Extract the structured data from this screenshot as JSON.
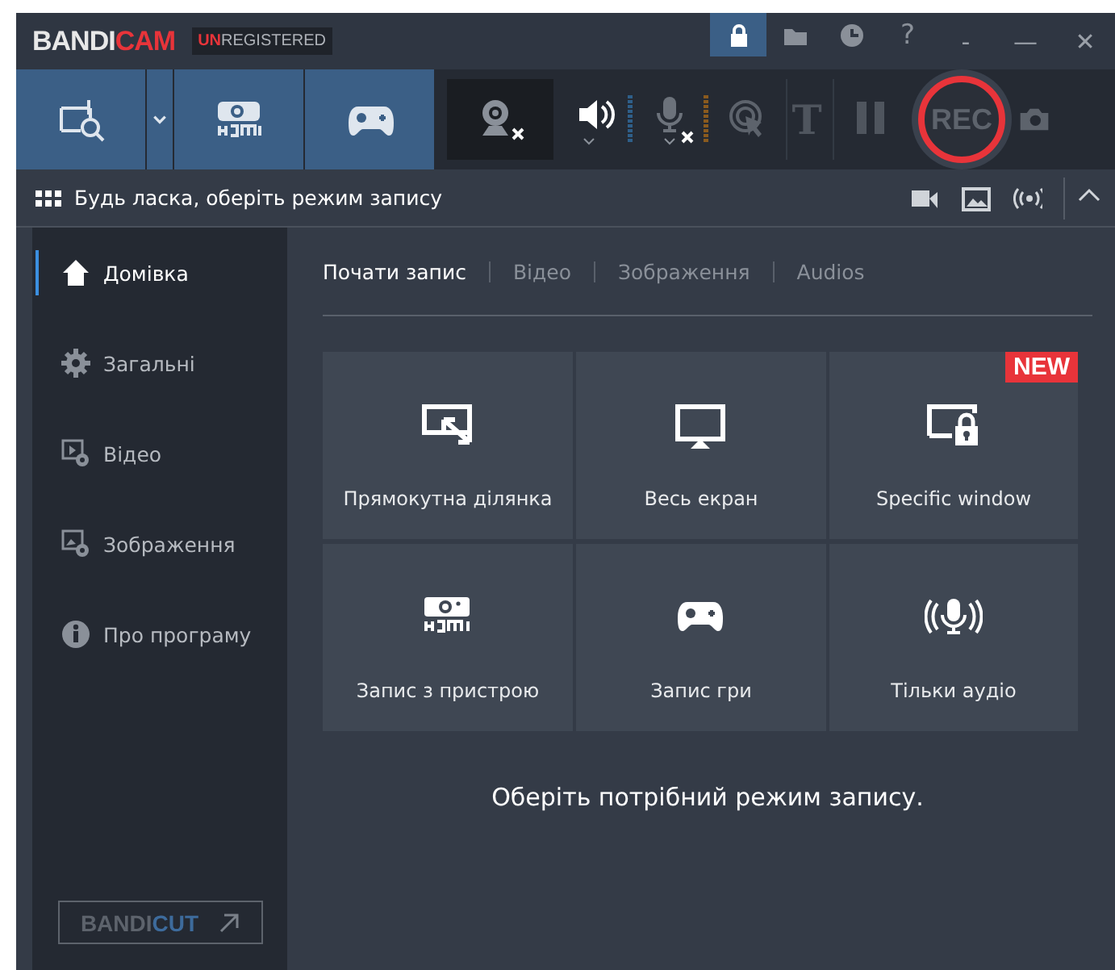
{
  "title_bar": {
    "logo": [
      "BANDI",
      "CAM"
    ],
    "badge": [
      "UN",
      "REGISTERED"
    ],
    "tools": [
      {
        "kind": "lock",
        "selected": true
      },
      {
        "kind": "folder",
        "selected": false
      },
      {
        "kind": "clock",
        "selected": false
      },
      {
        "kind": "help",
        "label": "?",
        "selected": false
      }
    ],
    "window_controls": [
      "-",
      "—",
      "✕"
    ]
  },
  "toolbar": {
    "modes": [
      {
        "kind": "rectangle"
      },
      {
        "kind": "dropdown"
      },
      {
        "kind": "hdmi"
      },
      {
        "kind": "gamepad"
      }
    ],
    "devices": [
      {
        "kind": "webcam",
        "off": true
      },
      {
        "kind": "speaker",
        "off": false
      },
      {
        "kind": "mic",
        "off": true
      },
      {
        "kind": "cursor",
        "off": false
      },
      {
        "kind": "text",
        "label": "T",
        "off": false
      },
      {
        "kind": "pause",
        "off": false
      }
    ],
    "record": "REC"
  },
  "mode_bar": {
    "message": "Будь ласка, оберіть режим запису",
    "icons": [
      {
        "kind": "video"
      },
      {
        "kind": "image"
      },
      {
        "kind": "broadcast"
      },
      {
        "kind": "collapse"
      }
    ]
  },
  "sidebar": {
    "items": [
      {
        "kind": "home",
        "label": "Домівка",
        "selected": true
      },
      {
        "kind": "gear",
        "label": "Загальні",
        "selected": false
      },
      {
        "kind": "video",
        "label": "Відео",
        "selected": false
      },
      {
        "kind": "image",
        "label": "Зображення",
        "selected": false
      },
      {
        "kind": "info",
        "label": "Про програму",
        "selected": false
      }
    ],
    "bandicut": [
      "BANDI",
      "CUT"
    ]
  },
  "tabs": [
    {
      "label": "Почати запис",
      "selected": true
    },
    {
      "label": "Відео",
      "selected": false
    },
    {
      "label": "Зображення",
      "selected": false
    },
    {
      "label": "Audios",
      "selected": false
    }
  ],
  "tiles": [
    {
      "kind": "rectangle",
      "label": "Прямокутна ділянка"
    },
    {
      "kind": "screen",
      "label": "Весь екран"
    },
    {
      "kind": "window",
      "label": "Specific window",
      "badge": "NEW"
    },
    {
      "kind": "hdmi",
      "label": "Запис з пристрою"
    },
    {
      "kind": "gamepad",
      "label": "Запис гри"
    },
    {
      "kind": "audio",
      "label": "Тільки аудіо"
    }
  ],
  "hint": "Оберіть потрібний режим запису."
}
